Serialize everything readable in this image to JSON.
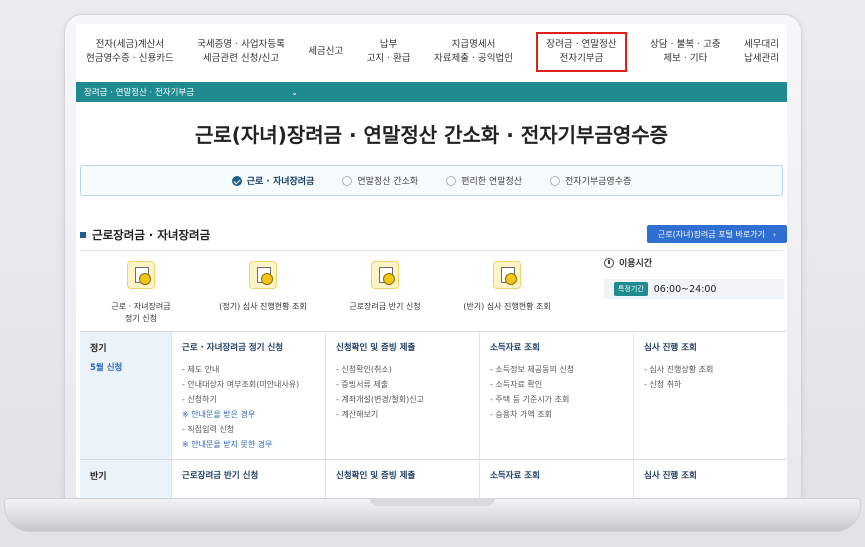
{
  "top_menu": [
    {
      "line1": "전자(세금)계산서",
      "line2": "현금영수증 · 신용카드"
    },
    {
      "line1": "국세증명 · 사업자등록",
      "line2": "세금관련 신청/신고"
    },
    {
      "line1": "세금신고",
      "line2": ""
    },
    {
      "line1": "납부",
      "line2": "고지 · 환급"
    },
    {
      "line1": "지급명세서",
      "line2": "자료제출 · 공익법인"
    },
    {
      "line1": "장려금 · 연말정산",
      "line2": "전자기부금",
      "active": true
    },
    {
      "line1": "상담 · 불복 · 고충",
      "line2": "제보 · 기타"
    },
    {
      "line1": "세무대리",
      "line2": "납세관리"
    }
  ],
  "breadcrumb": {
    "label": "장려금 · 연말정산 · 전자기부금"
  },
  "page_title": "근로(자녀)장려금 · 연말정산 간소화 · 전자기부금영수증",
  "tabs": [
    {
      "label": "근로 · 자녀장려금",
      "active": true
    },
    {
      "label": "연말정산 간소화"
    },
    {
      "label": "편리한 연말정산"
    },
    {
      "label": "전자기부금영수증"
    }
  ],
  "section": {
    "title": "근로장려금 · 자녀장려금",
    "portal_button": "근로(자녀)장려금 포털 바로가기"
  },
  "quick_links": [
    {
      "line1": "근로 · 자녀장려금",
      "line2": "정기 신청",
      "icon": "coin-person-icon"
    },
    {
      "line1": "(정기) 심사 진행현황 조회",
      "line2": "",
      "icon": "review-document-icon"
    },
    {
      "line1": "근로장려금 반기 신청",
      "line2": "",
      "icon": "apply-document-icon"
    },
    {
      "line1": "(반기) 심사 진행현황 조회",
      "line2": "",
      "icon": "check-document-icon"
    }
  ],
  "hours": {
    "title": "이용시간",
    "badge": "특정기간",
    "time": "06:00~24:00"
  },
  "grid": {
    "row1": {
      "kind": "정기",
      "period": "5월 신청",
      "columns": [
        {
          "head": "근로 · 자녀장려금 정기 신청",
          "items": [
            {
              "text": "- 제도 안내"
            },
            {
              "text": "- 안내대상자 여부조회(미안내사유)"
            },
            {
              "text": "- 신청하기"
            },
            {
              "text": "※ 안내문을 받은 경우",
              "note": true
            },
            {
              "text": "- 직접입력 신청"
            },
            {
              "text": "※ 안내문을 받지 못한 경우",
              "note": true
            }
          ]
        },
        {
          "head": "신청확인 및 증빙 제출",
          "items": [
            {
              "text": "- 신청확인(취소)"
            },
            {
              "text": "- 증빙서류 제출"
            },
            {
              "text": "- 계좌개설(변경/철회)신고"
            },
            {
              "text": "- 계산해보기"
            }
          ]
        },
        {
          "head": "소득자료 조회",
          "items": [
            {
              "text": "- 소득정보 제공동의 신청"
            },
            {
              "text": "- 소득자료 확인"
            },
            {
              "text": "- 주택 등 기준시가 조회"
            },
            {
              "text": "- 승용차 가액 조회"
            }
          ]
        },
        {
          "head": "심사 진행 조회",
          "items": [
            {
              "text": "- 심사 진행상황 조회"
            },
            {
              "text": "- 신청 취하"
            }
          ]
        }
      ]
    },
    "row2": {
      "kind": "반기",
      "columns": [
        {
          "head": "근로장려금 반기 신청"
        },
        {
          "head": "신청확인 및 증빙 제출"
        },
        {
          "head": "소득자료 조회"
        },
        {
          "head": "심사 진행 조회"
        }
      ]
    }
  }
}
